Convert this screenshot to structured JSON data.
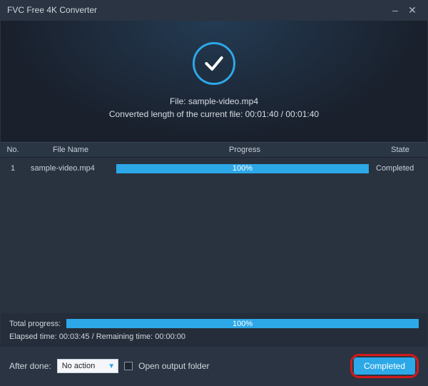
{
  "window": {
    "title": "FVC Free 4K Converter"
  },
  "hero": {
    "file_line": "File: sample-video.mp4",
    "converted_line": "Converted length of the current file: 00:01:40 / 00:01:40"
  },
  "table": {
    "headers": {
      "no": "No.",
      "file_name": "File Name",
      "progress": "Progress",
      "state": "State"
    },
    "rows": [
      {
        "no": "1",
        "file_name": "sample-video.mp4",
        "progress_pct": "100%",
        "state": "Completed"
      }
    ]
  },
  "summary": {
    "total_label": "Total progress:",
    "total_pct": "100%",
    "elapsed_line": "Elapsed time: 00:03:45 / Remaining time: 00:00:00"
  },
  "footer": {
    "after_done_label": "After done:",
    "after_done_value": "No action",
    "open_output_label": "Open output folder",
    "completed_label": "Completed"
  }
}
